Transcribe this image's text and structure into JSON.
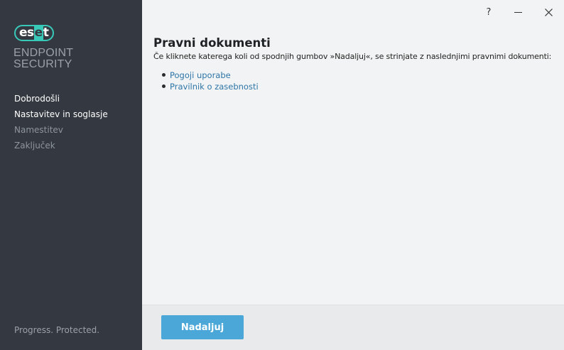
{
  "window": {
    "help_label": "?"
  },
  "sidebar": {
    "logo": {
      "left": "es",
      "mid": "e",
      "right": "t"
    },
    "product_line1": "ENDPOINT",
    "product_line2": "SECURITY",
    "nav": [
      {
        "label": "Dobrodošli",
        "state": "done"
      },
      {
        "label": "Nastavitev in soglasje",
        "state": "current"
      },
      {
        "label": "Namestitev",
        "state": "pending"
      },
      {
        "label": "Zaključek",
        "state": "pending"
      }
    ],
    "tagline": "Progress. Protected."
  },
  "main": {
    "title": "Pravni dokumenti",
    "intro": "Če kliknete katerega koli od spodnjih gumbov »Nadaljuj«, se strinjate z naslednjimi pravnimi dokumenti:",
    "documents": [
      {
        "label": "Pogoji uporabe"
      },
      {
        "label": "Pravilnik o zasebnosti"
      }
    ]
  },
  "footer": {
    "continue_label": "Nadaljuj"
  },
  "colors": {
    "sidebar_bg": "#343840",
    "brand_accent": "#39c9b9",
    "link": "#2d76a8",
    "primary_button": "#4ba7d8",
    "content_bg": "#f2f3f4"
  }
}
